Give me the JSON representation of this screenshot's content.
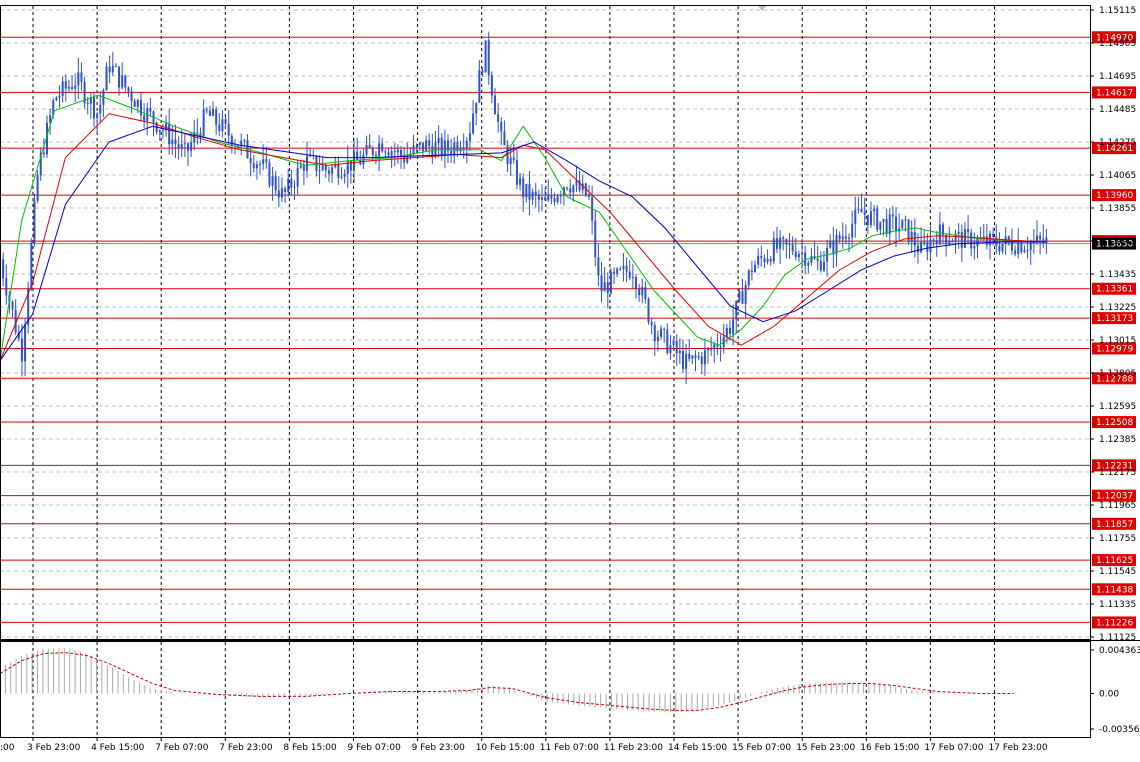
{
  "chart_data": {
    "type": "candlestick",
    "title": "",
    "price_axis": {
      "ylim": [
        1.1112,
        1.1517
      ],
      "ticks": [
        "1.15115",
        "1.14905",
        "1.14695",
        "1.14485",
        "1.14275",
        "1.14065",
        "1.13855",
        "1.13645",
        "1.13435",
        "1.13225",
        "1.13015",
        "1.12805",
        "1.12595",
        "1.12385",
        "1.12175",
        "1.11965",
        "1.11755",
        "1.11545",
        "1.11335",
        "1.11125"
      ],
      "current_price": "1.13650"
    },
    "time_axis": {
      "labels": [
        "3 Feb 23:00",
        "4 Feb 15:00",
        "7 Feb 07:00",
        "7 Feb 23:00",
        "8 Feb 15:00",
        "9 Feb 07:00",
        "9 Feb 23:00",
        "10 Feb 15:00",
        "11 Feb 07:00",
        "11 Feb 23:00",
        "14 Feb 15:00",
        "15 Feb 07:00",
        "15 Feb 23:00",
        "16 Feb 15:00",
        "17 Feb 07:00",
        "17 Feb 23:00"
      ],
      "partial_left_label": ":00"
    },
    "levels": [
      "1.14970",
      "1.14617",
      "1.14261",
      "1.13960",
      "1.13666",
      "1.13361",
      "1.13173",
      "1.12979",
      "1.12788",
      "1.12508",
      "1.12231",
      "1.12037",
      "1.11857",
      "1.11625",
      "1.11438",
      "1.11226"
    ],
    "price_path": [
      [
        0,
        1.1355
      ],
      [
        0.02,
        1.1295
      ],
      [
        0.035,
        1.1412
      ],
      [
        0.05,
        1.1458
      ],
      [
        0.07,
        1.147
      ],
      [
        0.09,
        1.1448
      ],
      [
        0.1,
        1.148
      ],
      [
        0.115,
        1.1465
      ],
      [
        0.13,
        1.1452
      ],
      [
        0.15,
        1.1438
      ],
      [
        0.17,
        1.1422
      ],
      [
        0.19,
        1.1448
      ],
      [
        0.21,
        1.1435
      ],
      [
        0.24,
        1.1415
      ],
      [
        0.26,
        1.1395
      ],
      [
        0.28,
        1.1418
      ],
      [
        0.3,
        1.1412
      ],
      [
        0.33,
        1.1418
      ],
      [
        0.35,
        1.143
      ],
      [
        0.37,
        1.142
      ],
      [
        0.39,
        1.1428
      ],
      [
        0.41,
        1.1425
      ],
      [
        0.43,
        1.1435
      ],
      [
        0.445,
        1.149
      ],
      [
        0.46,
        1.143
      ],
      [
        0.48,
        1.1398
      ],
      [
        0.5,
        1.139
      ],
      [
        0.52,
        1.1405
      ],
      [
        0.54,
        1.1395
      ],
      [
        0.55,
        1.1335
      ],
      [
        0.58,
        1.135
      ],
      [
        0.6,
        1.131
      ],
      [
        0.63,
        1.1288
      ],
      [
        0.65,
        1.1295
      ],
      [
        0.67,
        1.1312
      ],
      [
        0.69,
        1.135
      ],
      [
        0.71,
        1.1362
      ],
      [
        0.73,
        1.1362
      ],
      [
        0.75,
        1.1352
      ],
      [
        0.77,
        1.1368
      ],
      [
        0.79,
        1.1385
      ],
      [
        0.81,
        1.1378
      ],
      [
        0.83,
        1.1375
      ],
      [
        0.845,
        1.136
      ],
      [
        0.86,
        1.1372
      ],
      [
        0.88,
        1.1368
      ],
      [
        0.9,
        1.1366
      ],
      [
        0.92,
        1.1365
      ],
      [
        0.94,
        1.1365
      ],
      [
        0.96,
        1.1366
      ]
    ],
    "ma_series": [
      {
        "color": "#00c000",
        "pts": [
          [
            0,
            1.129
          ],
          [
            0.02,
            1.138
          ],
          [
            0.05,
            1.145
          ],
          [
            0.09,
            1.146
          ],
          [
            0.12,
            1.1452
          ],
          [
            0.16,
            1.144
          ],
          [
            0.2,
            1.143
          ],
          [
            0.24,
            1.1423
          ],
          [
            0.28,
            1.1415
          ],
          [
            0.32,
            1.1418
          ],
          [
            0.36,
            1.142
          ],
          [
            0.4,
            1.1425
          ],
          [
            0.44,
            1.1425
          ],
          [
            0.46,
            1.1418
          ],
          [
            0.48,
            1.144
          ],
          [
            0.5,
            1.142
          ],
          [
            0.52,
            1.1395
          ],
          [
            0.55,
            1.1385
          ],
          [
            0.57,
            1.1365
          ],
          [
            0.6,
            1.1335
          ],
          [
            0.62,
            1.132
          ],
          [
            0.64,
            1.1305
          ],
          [
            0.66,
            1.13
          ],
          [
            0.68,
            1.131
          ],
          [
            0.7,
            1.1325
          ],
          [
            0.72,
            1.1345
          ],
          [
            0.74,
            1.1355
          ],
          [
            0.76,
            1.1358
          ],
          [
            0.78,
            1.1362
          ],
          [
            0.8,
            1.137
          ],
          [
            0.82,
            1.1373
          ],
          [
            0.84,
            1.1375
          ],
          [
            0.86,
            1.1372
          ],
          [
            0.88,
            1.137
          ],
          [
            0.9,
            1.1368
          ],
          [
            0.96,
            1.1366
          ]
        ]
      },
      {
        "color": "#e00000",
        "pts": [
          [
            0,
            1.129
          ],
          [
            0.03,
            1.134
          ],
          [
            0.06,
            1.142
          ],
          [
            0.1,
            1.1448
          ],
          [
            0.14,
            1.1442
          ],
          [
            0.18,
            1.1433
          ],
          [
            0.22,
            1.1425
          ],
          [
            0.26,
            1.142
          ],
          [
            0.3,
            1.1415
          ],
          [
            0.34,
            1.1418
          ],
          [
            0.38,
            1.142
          ],
          [
            0.42,
            1.1422
          ],
          [
            0.46,
            1.142
          ],
          [
            0.48,
            1.1428
          ],
          [
            0.5,
            1.1425
          ],
          [
            0.53,
            1.1405
          ],
          [
            0.56,
            1.1385
          ],
          [
            0.59,
            1.136
          ],
          [
            0.62,
            1.1335
          ],
          [
            0.65,
            1.1312
          ],
          [
            0.68,
            1.13
          ],
          [
            0.71,
            1.1312
          ],
          [
            0.74,
            1.133
          ],
          [
            0.77,
            1.1348
          ],
          [
            0.8,
            1.136
          ],
          [
            0.83,
            1.1368
          ],
          [
            0.86,
            1.137
          ],
          [
            0.89,
            1.1369
          ],
          [
            0.93,
            1.1367
          ],
          [
            0.96,
            1.1366
          ]
        ]
      },
      {
        "color": "#0000c0",
        "pts": [
          [
            0,
            1.129
          ],
          [
            0.03,
            1.132
          ],
          [
            0.06,
            1.139
          ],
          [
            0.1,
            1.143
          ],
          [
            0.14,
            1.144
          ],
          [
            0.18,
            1.1434
          ],
          [
            0.22,
            1.1428
          ],
          [
            0.26,
            1.1424
          ],
          [
            0.3,
            1.142
          ],
          [
            0.34,
            1.142
          ],
          [
            0.38,
            1.1421
          ],
          [
            0.42,
            1.1422
          ],
          [
            0.46,
            1.1423
          ],
          [
            0.49,
            1.143
          ],
          [
            0.52,
            1.1418
          ],
          [
            0.55,
            1.1405
          ],
          [
            0.58,
            1.1395
          ],
          [
            0.61,
            1.1375
          ],
          [
            0.64,
            1.135
          ],
          [
            0.67,
            1.1325
          ],
          [
            0.7,
            1.1315
          ],
          [
            0.73,
            1.1322
          ],
          [
            0.76,
            1.1335
          ],
          [
            0.79,
            1.1348
          ],
          [
            0.82,
            1.1357
          ],
          [
            0.85,
            1.1362
          ],
          [
            0.88,
            1.1365
          ],
          [
            0.92,
            1.1366
          ],
          [
            0.96,
            1.1366
          ]
        ]
      }
    ],
    "oscillator": {
      "ticks": [
        "0.004363",
        "0.00",
        "-0.003568"
      ],
      "ylim": [
        -0.003568,
        0.004363
      ],
      "histogram": [
        [
          0,
          0.0025
        ],
        [
          0.02,
          0.0038
        ],
        [
          0.04,
          0.0045
        ],
        [
          0.06,
          0.0046
        ],
        [
          0.08,
          0.004
        ],
        [
          0.1,
          0.0028
        ],
        [
          0.12,
          0.0015
        ],
        [
          0.14,
          0.0005
        ],
        [
          0.16,
          0.0001
        ],
        [
          0.2,
          -0.0002
        ],
        [
          0.24,
          -0.0004
        ],
        [
          0.28,
          -0.0003
        ],
        [
          0.32,
          0.0001
        ],
        [
          0.36,
          0.0003
        ],
        [
          0.4,
          0.0001
        ],
        [
          0.43,
          0.0004
        ],
        [
          0.45,
          0.0008
        ],
        [
          0.47,
          0.0004
        ],
        [
          0.5,
          -0.0008
        ],
        [
          0.53,
          -0.0012
        ],
        [
          0.56,
          -0.0015
        ],
        [
          0.58,
          -0.0017
        ],
        [
          0.6,
          -0.0018
        ],
        [
          0.62,
          -0.0019
        ],
        [
          0.64,
          -0.0016
        ],
        [
          0.66,
          -0.0012
        ],
        [
          0.68,
          -0.0006
        ],
        [
          0.7,
          0.0002
        ],
        [
          0.72,
          0.0007
        ],
        [
          0.74,
          0.001
        ],
        [
          0.76,
          0.0011
        ],
        [
          0.78,
          0.0011
        ],
        [
          0.8,
          0.001
        ],
        [
          0.82,
          0.0007
        ],
        [
          0.84,
          0.0003
        ],
        [
          0.86,
          0.0001
        ],
        [
          0.9,
          0.0
        ],
        [
          0.93,
          0.0
        ]
      ],
      "signal": [
        [
          0,
          0.002
        ],
        [
          0.02,
          0.0033
        ],
        [
          0.04,
          0.004
        ],
        [
          0.06,
          0.0041
        ],
        [
          0.08,
          0.0038
        ],
        [
          0.1,
          0.003
        ],
        [
          0.12,
          0.002
        ],
        [
          0.14,
          0.001
        ],
        [
          0.16,
          0.0003
        ],
        [
          0.2,
          -0.0001
        ],
        [
          0.24,
          -0.0003
        ],
        [
          0.28,
          -0.0003
        ],
        [
          0.32,
          0.0
        ],
        [
          0.36,
          0.0002
        ],
        [
          0.4,
          0.0002
        ],
        [
          0.43,
          0.0003
        ],
        [
          0.45,
          0.0006
        ],
        [
          0.47,
          0.0005
        ],
        [
          0.5,
          -0.0004
        ],
        [
          0.53,
          -0.0009
        ],
        [
          0.56,
          -0.0012
        ],
        [
          0.58,
          -0.0014
        ],
        [
          0.6,
          -0.0016
        ],
        [
          0.62,
          -0.0017
        ],
        [
          0.64,
          -0.0017
        ],
        [
          0.66,
          -0.0014
        ],
        [
          0.68,
          -0.0009
        ],
        [
          0.7,
          -0.0003
        ],
        [
          0.72,
          0.0003
        ],
        [
          0.74,
          0.0007
        ],
        [
          0.76,
          0.0009
        ],
        [
          0.78,
          0.001
        ],
        [
          0.8,
          0.001
        ],
        [
          0.82,
          0.0008
        ],
        [
          0.84,
          0.0005
        ],
        [
          0.86,
          0.0002
        ],
        [
          0.9,
          0.0
        ],
        [
          0.93,
          0.0
        ]
      ]
    },
    "colors": {
      "candle": "#3050c8",
      "level_line": "#e00000",
      "level_label_bg": "#e00000",
      "grid": "#c0c0c0",
      "osc_histogram": "#a8a8a8",
      "osc_signal": "#d00000",
      "current_price_bg": "#000000"
    }
  }
}
